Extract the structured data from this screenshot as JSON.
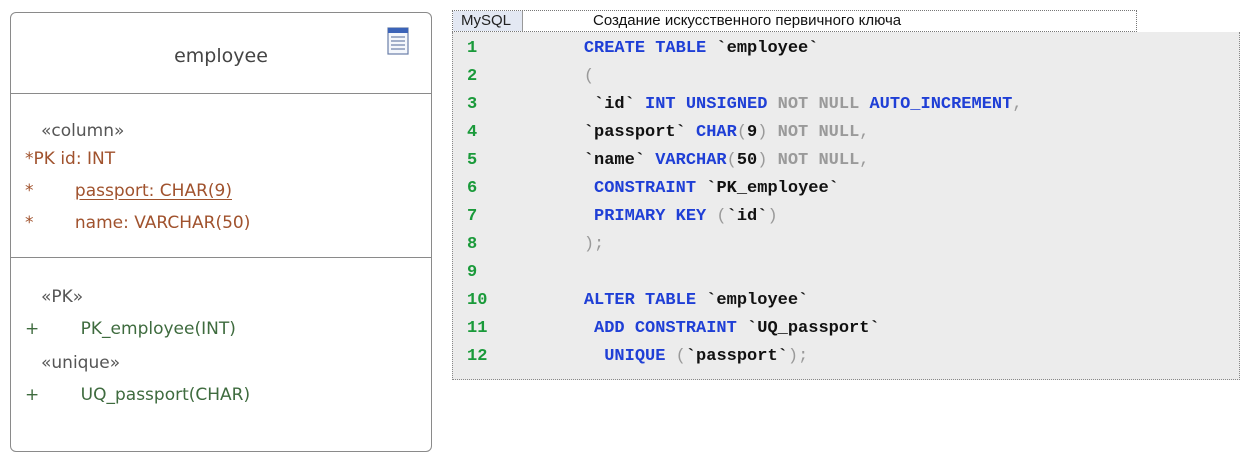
{
  "entity": {
    "title": "employee",
    "icon": "table-icon",
    "columns_stereotype": "«column»",
    "columns": [
      {
        "marker": "*PK",
        "text": "id: INT",
        "underlined": false
      },
      {
        "marker": "*",
        "text": "passport: CHAR(9)",
        "underlined": true
      },
      {
        "marker": "*",
        "text": "name: VARCHAR(50)",
        "underlined": false
      }
    ],
    "pk_stereotype": "«PK»",
    "pk_ops": [
      {
        "marker": "+",
        "text": "PK_employee(INT)"
      }
    ],
    "unique_stereotype": "«unique»",
    "unique_ops": [
      {
        "marker": "+",
        "text": "UQ_passport(CHAR)"
      }
    ]
  },
  "code": {
    "language": "MySQL",
    "caption": "Создание искусственного первичного ключа",
    "lines": [
      {
        "n": "1",
        "tokens": [
          [
            "    ",
            "id"
          ],
          [
            "CREATE TABLE",
            "kw"
          ],
          [
            " `employee`",
            "id"
          ]
        ]
      },
      {
        "n": "2",
        "tokens": [
          [
            "    ",
            "id"
          ],
          [
            "(",
            "pn"
          ]
        ]
      },
      {
        "n": "3",
        "tokens": [
          [
            "     `id` ",
            "id"
          ],
          [
            "INT UNSIGNED",
            "kw"
          ],
          [
            " NOT NULL ",
            "nn"
          ],
          [
            "AUTO_INCREMENT",
            "kw"
          ],
          [
            ",",
            "pn"
          ]
        ]
      },
      {
        "n": "4",
        "tokens": [
          [
            "    `passport` ",
            "id"
          ],
          [
            "CHAR",
            "kw"
          ],
          [
            "(",
            "pn"
          ],
          [
            "9",
            "id"
          ],
          [
            ")",
            "pn"
          ],
          [
            " NOT NULL",
            "nn"
          ],
          [
            ",",
            "pn"
          ]
        ]
      },
      {
        "n": "5",
        "tokens": [
          [
            "    `name` ",
            "id"
          ],
          [
            "VARCHAR",
            "kw"
          ],
          [
            "(",
            "pn"
          ],
          [
            "50",
            "id"
          ],
          [
            ")",
            "pn"
          ],
          [
            " NOT NULL",
            "nn"
          ],
          [
            ",",
            "pn"
          ]
        ]
      },
      {
        "n": "6",
        "tokens": [
          [
            "     ",
            "id"
          ],
          [
            "CONSTRAINT",
            "kw"
          ],
          [
            " `PK_employee`",
            "id"
          ]
        ]
      },
      {
        "n": "7",
        "tokens": [
          [
            "     ",
            "id"
          ],
          [
            "PRIMARY KEY",
            "kw"
          ],
          [
            " (",
            "pn"
          ],
          [
            "`id`",
            "id"
          ],
          [
            ")",
            "pn"
          ]
        ]
      },
      {
        "n": "8",
        "tokens": [
          [
            "    ",
            "id"
          ],
          [
            ");",
            "pn"
          ]
        ]
      },
      {
        "n": "9",
        "tokens": []
      },
      {
        "n": "10",
        "tokens": [
          [
            "    ",
            "id"
          ],
          [
            "ALTER TABLE",
            "kw"
          ],
          [
            " `employee`",
            "id"
          ]
        ]
      },
      {
        "n": "11",
        "tokens": [
          [
            "     ",
            "id"
          ],
          [
            "ADD CONSTRAINT",
            "kw"
          ],
          [
            " `UQ_passport`",
            "id"
          ]
        ]
      },
      {
        "n": "12",
        "tokens": [
          [
            "      ",
            "id"
          ],
          [
            "UNIQUE",
            "kw"
          ],
          [
            " (",
            "pn"
          ],
          [
            "`passport`",
            "id"
          ],
          [
            ");",
            "pn"
          ]
        ]
      }
    ]
  }
}
